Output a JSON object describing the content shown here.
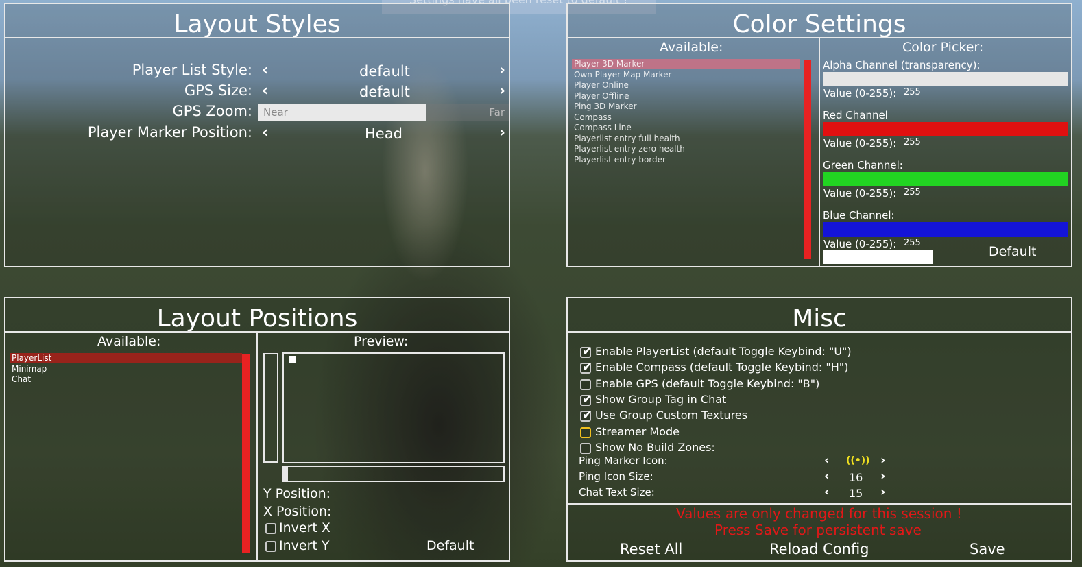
{
  "toast": "Settings have all been reset to default !",
  "layout_styles": {
    "title": "Layout Styles",
    "rows": [
      {
        "label": "Player List Style:",
        "value": "default"
      },
      {
        "label": "GPS Size:",
        "value": "default"
      },
      {
        "label": "GPS Zoom:",
        "slider_near": "Near",
        "slider_far": "Far",
        "level": 0.67
      },
      {
        "label": "Player Marker Position:",
        "value": "Head"
      }
    ],
    "arrow_left": "‹",
    "arrow_right": "›"
  },
  "color_settings": {
    "title": "Color Settings",
    "available_label": "Available:",
    "items": [
      "Player 3D Marker",
      "Own Player Map Marker",
      "Player Online",
      "Player Offline",
      "Ping 3D Marker",
      "Compass",
      "Compass Line",
      "Playerlist entry full health",
      "Playerlist entry zero health",
      "Playerlist entry border"
    ],
    "selected_index": 0,
    "picker_label": "Color Picker:",
    "channels": [
      {
        "label": "Alpha Channel (transparency):",
        "value_label": "Value (0-255):",
        "value": "255",
        "color": "#e6e6e6"
      },
      {
        "label": "Red Channel",
        "value_label": "Value (0-255):",
        "value": "255",
        "color": "#e01010"
      },
      {
        "label": "Green Channel:",
        "value_label": "Value (0-255):",
        "value": "255",
        "color": "#22d422"
      },
      {
        "label": "Blue Channel:",
        "value_label": "Value (0-255):",
        "value": "255",
        "color": "#1414d8"
      }
    ],
    "default_button": "Default",
    "preview_color": "#ffffff"
  },
  "layout_positions": {
    "title": "Layout Positions",
    "available_label": "Available:",
    "items": [
      "PlayerList",
      "Minimap",
      "Chat"
    ],
    "selected_index": 0,
    "preview_label": "Preview:",
    "y_label": "Y Position:",
    "x_label": "X Position:",
    "invert_x": "Invert X",
    "invert_y": "Invert Y",
    "default_button": "Default"
  },
  "misc": {
    "title": "Misc",
    "checkboxes": [
      {
        "label": "Enable PlayerList (default Toggle Keybind: \"U\")",
        "checked": true
      },
      {
        "label": "Enable Compass (default Toggle Keybind: \"H\")",
        "checked": true
      },
      {
        "label": "Enable GPS (default Toggle Keybind: \"B\")",
        "checked": false
      },
      {
        "label": "Show Group Tag in Chat",
        "checked": true
      },
      {
        "label": "Use Group Custom Textures",
        "checked": true
      },
      {
        "label": "Streamer Mode",
        "checked": false
      },
      {
        "label": "Show No Build Zones:",
        "checked": false
      }
    ],
    "steppers": [
      {
        "label": "Ping Marker Icon:",
        "value": "((•))"
      },
      {
        "label": "Ping Icon Size:",
        "value": "16"
      },
      {
        "label": "Chat Text Size:",
        "value": "15"
      }
    ],
    "notice_line1": "Values are only changed for this session !",
    "notice_line2": "Press Save for persistent save",
    "reset_all": "Reset All",
    "reload_config": "Reload Config",
    "save": "Save",
    "accent": "#f0e020"
  }
}
